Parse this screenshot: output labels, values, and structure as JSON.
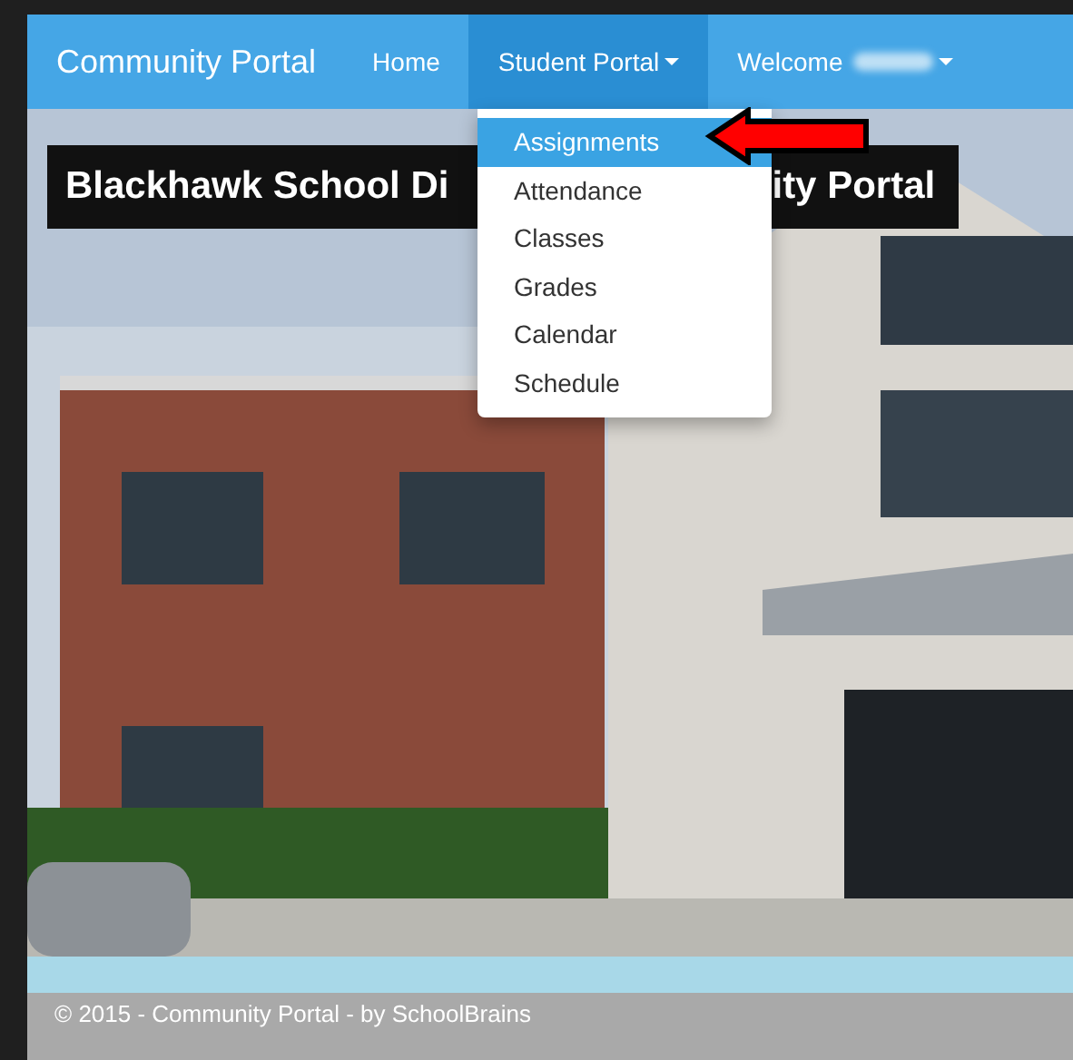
{
  "navbar": {
    "brand": "Community Portal",
    "items": [
      {
        "label": "Home",
        "selected": false,
        "caret": false,
        "redacted": false
      },
      {
        "label": "Student Portal",
        "selected": true,
        "caret": true,
        "redacted": false
      },
      {
        "label": "Welcome",
        "selected": false,
        "caret": true,
        "redacted": true
      }
    ]
  },
  "dropdown": {
    "items": [
      {
        "label": "Assignments",
        "selected": true
      },
      {
        "label": "Attendance",
        "selected": false
      },
      {
        "label": "Classes",
        "selected": false
      },
      {
        "label": "Grades",
        "selected": false
      },
      {
        "label": "Calendar",
        "selected": false
      },
      {
        "label": "Schedule",
        "selected": false
      }
    ]
  },
  "banner": {
    "visible_parts": [
      "Blackhawk School Di",
      "ity Portal"
    ]
  },
  "footer": {
    "text": "© 2015 - Community Portal - by SchoolBrains"
  }
}
